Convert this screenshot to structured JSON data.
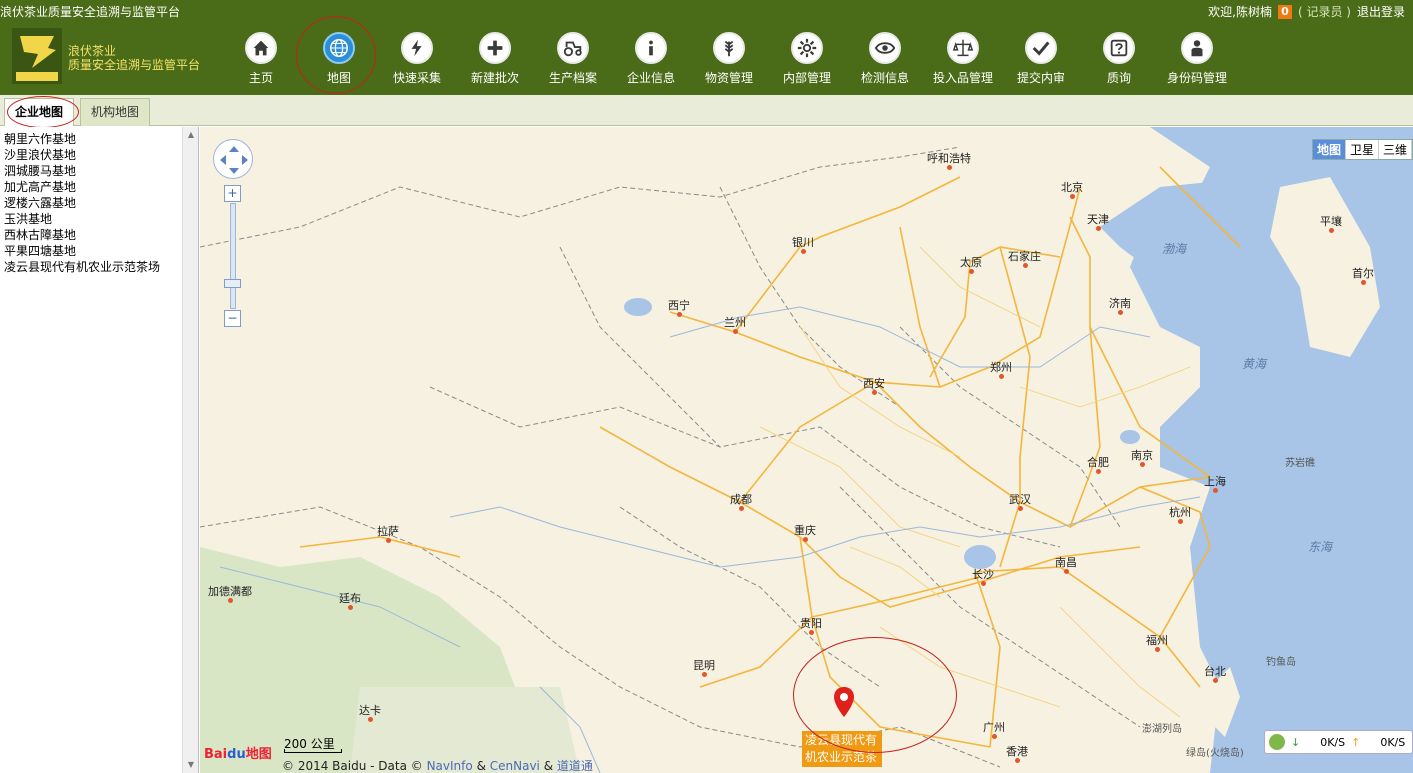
{
  "header": {
    "site_title": "浪伏茶业质量安全追溯与监管平台",
    "welcome": "欢迎,",
    "username": "陈树楠",
    "message_count": "0",
    "role": "( 记录员 )",
    "logout": "退出登录",
    "logo_line1": "浪伏茶业",
    "logo_line2": "质量安全追溯与监管平台"
  },
  "nav": [
    {
      "label": "主页",
      "icon": "home-icon"
    },
    {
      "label": "地图",
      "icon": "globe-icon"
    },
    {
      "label": "快速采集",
      "icon": "quick-collect-icon"
    },
    {
      "label": "新建批次",
      "icon": "plus-icon"
    },
    {
      "label": "生产档案",
      "icon": "tractor-icon"
    },
    {
      "label": "企业信息",
      "icon": "info-icon"
    },
    {
      "label": "物资管理",
      "icon": "wheat-icon"
    },
    {
      "label": "内部管理",
      "icon": "gear-icon"
    },
    {
      "label": "检测信息",
      "icon": "eye-icon"
    },
    {
      "label": "投入品管理",
      "icon": "scale-icon"
    },
    {
      "label": "提交内审",
      "icon": "check-icon"
    },
    {
      "label": "质询",
      "icon": "question-icon"
    },
    {
      "label": "身份码管理",
      "icon": "person-icon"
    }
  ],
  "tabs": {
    "enterprise_map": "企业地图",
    "org_map": "机构地图"
  },
  "bases": [
    "朝里六作基地",
    "沙里浪伏基地",
    "泗城腰马基地",
    "加尤高产基地",
    "逻楼六露基地",
    "玉洪基地",
    "西林古障基地",
    "平果四塘基地",
    "凌云县现代有机农业示范茶场"
  ],
  "map": {
    "types": [
      "地图",
      "卫星",
      "三维"
    ],
    "zoom_in": "+",
    "zoom_out": "−",
    "marker_label": "凌云县现代有机农业示范茶",
    "scale": "200 公里",
    "logo_a": "Bai",
    "logo_b": "du",
    "logo_c": "地图",
    "copyright_text": "© 2014 Baidu - Data ©",
    "navinfo": "NavInfo",
    "amp1": "&",
    "cennavi": "CenNavi",
    "amp2": "&",
    "daodaotong": "道道通",
    "speed_down": "0K/S",
    "speed_up": "0K/S",
    "cities": [
      {
        "name": "呼和浩特"
      },
      {
        "name": "北京"
      },
      {
        "name": "天津"
      },
      {
        "name": "银川"
      },
      {
        "name": "太原"
      },
      {
        "name": "石家庄"
      },
      {
        "name": "济南"
      },
      {
        "name": "西宁"
      },
      {
        "name": "兰州"
      },
      {
        "name": "郑州"
      },
      {
        "name": "西安"
      },
      {
        "name": "合肥"
      },
      {
        "name": "南京"
      },
      {
        "name": "上海"
      },
      {
        "name": "成都"
      },
      {
        "name": "武汉"
      },
      {
        "name": "杭州"
      },
      {
        "name": "拉萨"
      },
      {
        "name": "重庆"
      },
      {
        "name": "长沙"
      },
      {
        "name": "南昌"
      },
      {
        "name": "加德满都"
      },
      {
        "name": "廷布"
      },
      {
        "name": "贵阳"
      },
      {
        "name": "福州"
      },
      {
        "name": "昆明"
      },
      {
        "name": "台北"
      },
      {
        "name": "广州"
      },
      {
        "name": "达卡"
      },
      {
        "name": "香港"
      },
      {
        "name": "平壤"
      },
      {
        "name": "首尔"
      }
    ],
    "seas": [
      "渤海",
      "黄海",
      "东海"
    ],
    "islands": [
      "苏岩礁",
      "钓鱼岛",
      "澎湖列岛",
      "绿岛(火烧岛)"
    ]
  }
}
